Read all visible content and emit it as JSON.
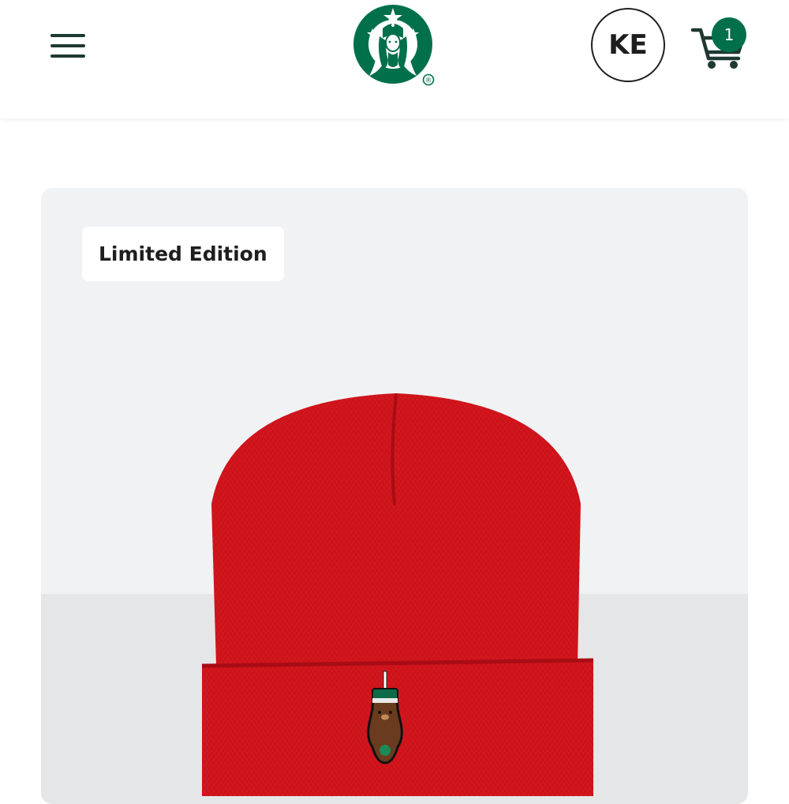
{
  "header": {
    "menu_icon": "hamburger-menu-icon",
    "logo": "starbucks-siren-logo",
    "registered_mark": "®",
    "avatar_initials": "KE",
    "cart_icon": "shopping-cart-icon",
    "cart_count": "1"
  },
  "product": {
    "badge_label": "Limited Edition",
    "image": "red-knit-beanie-with-bear-patch"
  },
  "colors": {
    "brand_green": "#00704a",
    "dark_green": "#1e3932",
    "beanie_red": "#d4161d",
    "card_background": "#f1f2f4"
  }
}
